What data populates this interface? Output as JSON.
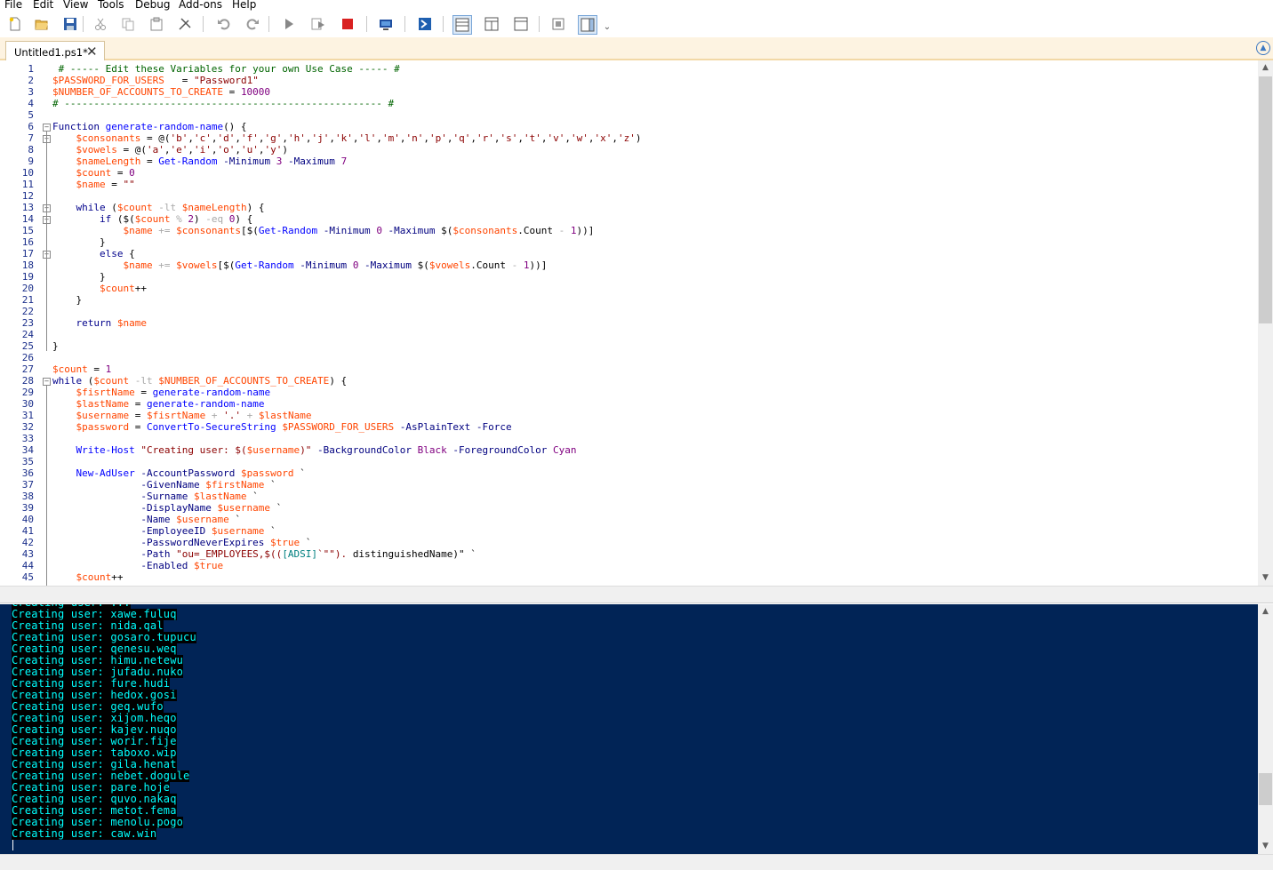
{
  "menu": [
    "File",
    "Edit",
    "View",
    "Tools",
    "Debug",
    "Add-ons",
    "Help"
  ],
  "toolbar": {
    "buttons": [
      "new-icon",
      "open-icon",
      "save-icon",
      "cut-icon",
      "copy-icon",
      "paste-icon",
      "clear-icon",
      "undo-icon",
      "redo-icon",
      "run-icon",
      "run-selection-icon",
      "stop-icon",
      "remote-icon",
      "powershell-icon",
      "layout-top-icon",
      "layout-right-icon",
      "layout-max-icon",
      "commands-icon",
      "addon-icon"
    ],
    "overflow": "⌄"
  },
  "tab": {
    "label": "Untitled1.ps1*",
    "close": "✕"
  },
  "editor": {
    "line_numbers": [
      "1",
      "2",
      "3",
      "4",
      "5",
      "6",
      "7",
      "8",
      "9",
      "10",
      "11",
      "12",
      "13",
      "14",
      "15",
      "16",
      "17",
      "18",
      "19",
      "20",
      "21",
      "22",
      "23",
      "24",
      "25",
      "26",
      "27",
      "28",
      "29",
      "30",
      "31",
      "32",
      "33",
      "34",
      "35",
      "36",
      "37",
      "38",
      "39",
      "40",
      "41",
      "42",
      "43",
      "44",
      "45"
    ],
    "lines": [
      [
        [
          "c",
          " # ----- Edit these Variables for your own Use Case ----- #"
        ]
      ],
      [
        [
          "v",
          "$PASSWORD_FOR_USERS"
        ],
        [
          "p",
          "   = "
        ],
        [
          "s",
          "\"Password1\""
        ]
      ],
      [
        [
          "v",
          "$NUMBER_OF_ACCOUNTS_TO_CREATE"
        ],
        [
          "p",
          " = "
        ],
        [
          "n",
          "10000"
        ]
      ],
      [
        [
          "c",
          "# ------------------------------------------------------ #"
        ]
      ],
      [],
      [
        [
          "k",
          "Function "
        ],
        [
          "m",
          "generate-random-name"
        ],
        [
          "p",
          "() {"
        ]
      ],
      [
        [
          "p",
          "    "
        ],
        [
          "v",
          "$consonants"
        ],
        [
          "p",
          " = @("
        ],
        [
          "s",
          "'b'"
        ],
        [
          "p",
          ","
        ],
        [
          "s",
          "'c'"
        ],
        [
          "p",
          ","
        ],
        [
          "s",
          "'d'"
        ],
        [
          "p",
          ","
        ],
        [
          "s",
          "'f'"
        ],
        [
          "p",
          ","
        ],
        [
          "s",
          "'g'"
        ],
        [
          "p",
          ","
        ],
        [
          "s",
          "'h'"
        ],
        [
          "p",
          ","
        ],
        [
          "s",
          "'j'"
        ],
        [
          "p",
          ","
        ],
        [
          "s",
          "'k'"
        ],
        [
          "p",
          ","
        ],
        [
          "s",
          "'l'"
        ],
        [
          "p",
          ","
        ],
        [
          "s",
          "'m'"
        ],
        [
          "p",
          ","
        ],
        [
          "s",
          "'n'"
        ],
        [
          "p",
          ","
        ],
        [
          "s",
          "'p'"
        ],
        [
          "p",
          ","
        ],
        [
          "s",
          "'q'"
        ],
        [
          "p",
          ","
        ],
        [
          "s",
          "'r'"
        ],
        [
          "p",
          ","
        ],
        [
          "s",
          "'s'"
        ],
        [
          "p",
          ","
        ],
        [
          "s",
          "'t'"
        ],
        [
          "p",
          ","
        ],
        [
          "s",
          "'v'"
        ],
        [
          "p",
          ","
        ],
        [
          "s",
          "'w'"
        ],
        [
          "p",
          ","
        ],
        [
          "s",
          "'x'"
        ],
        [
          "p",
          ","
        ],
        [
          "s",
          "'z'"
        ],
        [
          "p",
          ")"
        ]
      ],
      [
        [
          "p",
          "    "
        ],
        [
          "v",
          "$vowels"
        ],
        [
          "p",
          " = @("
        ],
        [
          "s",
          "'a'"
        ],
        [
          "p",
          ","
        ],
        [
          "s",
          "'e'"
        ],
        [
          "p",
          ","
        ],
        [
          "s",
          "'i'"
        ],
        [
          "p",
          ","
        ],
        [
          "s",
          "'o'"
        ],
        [
          "p",
          ","
        ],
        [
          "s",
          "'u'"
        ],
        [
          "p",
          ","
        ],
        [
          "s",
          "'y'"
        ],
        [
          "p",
          ")"
        ]
      ],
      [
        [
          "p",
          "    "
        ],
        [
          "v",
          "$nameLength"
        ],
        [
          "p",
          " = "
        ],
        [
          "m",
          "Get-Random"
        ],
        [
          "a",
          " -Minimum "
        ],
        [
          "n",
          "3"
        ],
        [
          "a",
          " -Maximum "
        ],
        [
          "n",
          "7"
        ]
      ],
      [
        [
          "p",
          "    "
        ],
        [
          "v",
          "$count"
        ],
        [
          "p",
          " = "
        ],
        [
          "n",
          "0"
        ]
      ],
      [
        [
          "p",
          "    "
        ],
        [
          "v",
          "$name"
        ],
        [
          "p",
          " = "
        ],
        [
          "s",
          "\"\""
        ]
      ],
      [],
      [
        [
          "p",
          "    "
        ],
        [
          "k",
          "while"
        ],
        [
          "p",
          " ("
        ],
        [
          "v",
          "$count"
        ],
        [
          "o",
          " -lt "
        ],
        [
          "v",
          "$nameLength"
        ],
        [
          "p",
          ") {"
        ]
      ],
      [
        [
          "p",
          "        "
        ],
        [
          "k",
          "if"
        ],
        [
          "p",
          " ($("
        ],
        [
          "v",
          "$count"
        ],
        [
          "o",
          " % "
        ],
        [
          "n",
          "2"
        ],
        [
          "p",
          ") "
        ],
        [
          "o",
          "-eq "
        ],
        [
          "n",
          "0"
        ],
        [
          "p",
          ") {"
        ]
      ],
      [
        [
          "p",
          "            "
        ],
        [
          "v",
          "$name"
        ],
        [
          "o",
          " += "
        ],
        [
          "v",
          "$consonants"
        ],
        [
          "p",
          "[$("
        ],
        [
          "m",
          "Get-Random"
        ],
        [
          "a",
          " -Minimum "
        ],
        [
          "n",
          "0"
        ],
        [
          "a",
          " -Maximum "
        ],
        [
          "p",
          "$("
        ],
        [
          "v",
          "$consonants"
        ],
        [
          "p",
          ".Count "
        ],
        [
          "o",
          "- "
        ],
        [
          "n",
          "1"
        ],
        [
          "p",
          "))]"
        ]
      ],
      [
        [
          "p",
          "        }"
        ]
      ],
      [
        [
          "p",
          "        "
        ],
        [
          "k",
          "else"
        ],
        [
          "p",
          " {"
        ]
      ],
      [
        [
          "p",
          "            "
        ],
        [
          "v",
          "$name"
        ],
        [
          "o",
          " += "
        ],
        [
          "v",
          "$vowels"
        ],
        [
          "p",
          "[$("
        ],
        [
          "m",
          "Get-Random"
        ],
        [
          "a",
          " -Minimum "
        ],
        [
          "n",
          "0"
        ],
        [
          "a",
          " -Maximum "
        ],
        [
          "p",
          "$("
        ],
        [
          "v",
          "$vowels"
        ],
        [
          "p",
          ".Count "
        ],
        [
          "o",
          "- "
        ],
        [
          "n",
          "1"
        ],
        [
          "p",
          "))]"
        ]
      ],
      [
        [
          "p",
          "        }"
        ]
      ],
      [
        [
          "p",
          "        "
        ],
        [
          "v",
          "$count"
        ],
        [
          "p",
          "++"
        ]
      ],
      [
        [
          "p",
          "    }"
        ]
      ],
      [],
      [
        [
          "p",
          "    "
        ],
        [
          "k",
          "return "
        ],
        [
          "v",
          "$name"
        ]
      ],
      [],
      [
        [
          "p",
          "}"
        ]
      ],
      [],
      [
        [
          "v",
          "$count"
        ],
        [
          "p",
          " = "
        ],
        [
          "n",
          "1"
        ]
      ],
      [
        [
          "k",
          "while"
        ],
        [
          "p",
          " ("
        ],
        [
          "v",
          "$count"
        ],
        [
          "o",
          " -lt "
        ],
        [
          "v",
          "$NUMBER_OF_ACCOUNTS_TO_CREATE"
        ],
        [
          "p",
          ") {"
        ]
      ],
      [
        [
          "p",
          "    "
        ],
        [
          "v",
          "$fisrtName"
        ],
        [
          "p",
          " = "
        ],
        [
          "m",
          "generate-random-name"
        ]
      ],
      [
        [
          "p",
          "    "
        ],
        [
          "v",
          "$lastName"
        ],
        [
          "p",
          " = "
        ],
        [
          "m",
          "generate-random-name"
        ]
      ],
      [
        [
          "p",
          "    "
        ],
        [
          "v",
          "$username"
        ],
        [
          "p",
          " = "
        ],
        [
          "v",
          "$fisrtName"
        ],
        [
          "o",
          " + "
        ],
        [
          "s",
          "'.'"
        ],
        [
          "o",
          " + "
        ],
        [
          "v",
          "$lastName"
        ]
      ],
      [
        [
          "p",
          "    "
        ],
        [
          "v",
          "$password"
        ],
        [
          "p",
          " = "
        ],
        [
          "m",
          "ConvertTo-SecureString"
        ],
        [
          "p",
          " "
        ],
        [
          "v",
          "$PASSWORD_FOR_USERS"
        ],
        [
          "a",
          " -AsPlainText -Force"
        ]
      ],
      [],
      [
        [
          "p",
          "    "
        ],
        [
          "m",
          "Write-Host"
        ],
        [
          "p",
          " "
        ],
        [
          "s",
          "\"Creating user: $("
        ],
        [
          "v",
          "$username"
        ],
        [
          "s",
          ")\""
        ],
        [
          "a",
          " -BackgroundColor "
        ],
        [
          "n",
          "Black"
        ],
        [
          "a",
          " -ForegroundColor "
        ],
        [
          "n",
          "Cyan"
        ]
      ],
      [],
      [
        [
          "p",
          "    "
        ],
        [
          "m",
          "New-AdUser"
        ],
        [
          "a",
          " -AccountPassword "
        ],
        [
          "v",
          "$password"
        ],
        [
          "p",
          " `"
        ]
      ],
      [
        [
          "p",
          "               "
        ],
        [
          "a",
          "-GivenName "
        ],
        [
          "v",
          "$firstName"
        ],
        [
          "p",
          " `"
        ]
      ],
      [
        [
          "p",
          "               "
        ],
        [
          "a",
          "-Surname "
        ],
        [
          "v",
          "$lastName"
        ],
        [
          "p",
          " `"
        ]
      ],
      [
        [
          "p",
          "               "
        ],
        [
          "a",
          "-DisplayName "
        ],
        [
          "v",
          "$username"
        ],
        [
          "p",
          " `"
        ]
      ],
      [
        [
          "p",
          "               "
        ],
        [
          "a",
          "-Name "
        ],
        [
          "v",
          "$username"
        ],
        [
          "p",
          " `"
        ]
      ],
      [
        [
          "p",
          "               "
        ],
        [
          "a",
          "-EmployeeID "
        ],
        [
          "v",
          "$username"
        ],
        [
          "p",
          " `"
        ]
      ],
      [
        [
          "p",
          "               "
        ],
        [
          "a",
          "-PasswordNeverExpires "
        ],
        [
          "v",
          "$true"
        ],
        [
          "p",
          " `"
        ]
      ],
      [
        [
          "p",
          "               "
        ],
        [
          "a",
          "-Path "
        ],
        [
          "s",
          "\"ou=_EMPLOYEES,$(("
        ],
        [
          "t",
          "[ADSI]"
        ],
        [
          "s",
          "`\"\"). "
        ],
        [
          "p",
          "distinguishedName)\""
        ],
        [
          "p",
          " `"
        ]
      ],
      [
        [
          "p",
          "               "
        ],
        [
          "a",
          "-Enabled "
        ],
        [
          "v",
          "$true"
        ]
      ],
      [
        [
          "p",
          "    "
        ],
        [
          "v",
          "$count"
        ],
        [
          "p",
          "++"
        ]
      ]
    ]
  },
  "console": {
    "lines": [
      "Creating user: xawe.fuluq",
      "Creating user: nida.qal",
      "Creating user: gosaro.tupucu",
      "Creating user: qenesu.weq",
      "Creating user: himu.netewu",
      "Creating user: jufadu.nuko",
      "Creating user: fure.hudi",
      "Creating user: hedox.gosi",
      "Creating user: geq.wufo",
      "Creating user: xijom.heqo",
      "Creating user: kajev.nuqo",
      "Creating user: worir.fije",
      "Creating user: taboxo.wip",
      "Creating user: gila.henat",
      "Creating user: nebet.dogule",
      "Creating user: pare.hoje",
      "Creating user: quvo.nakaq",
      "Creating user: metot.fema",
      "Creating user: menolu.pogo",
      "Creating user: caw.win"
    ],
    "background": "#012456",
    "foreground": "#00ffff"
  }
}
